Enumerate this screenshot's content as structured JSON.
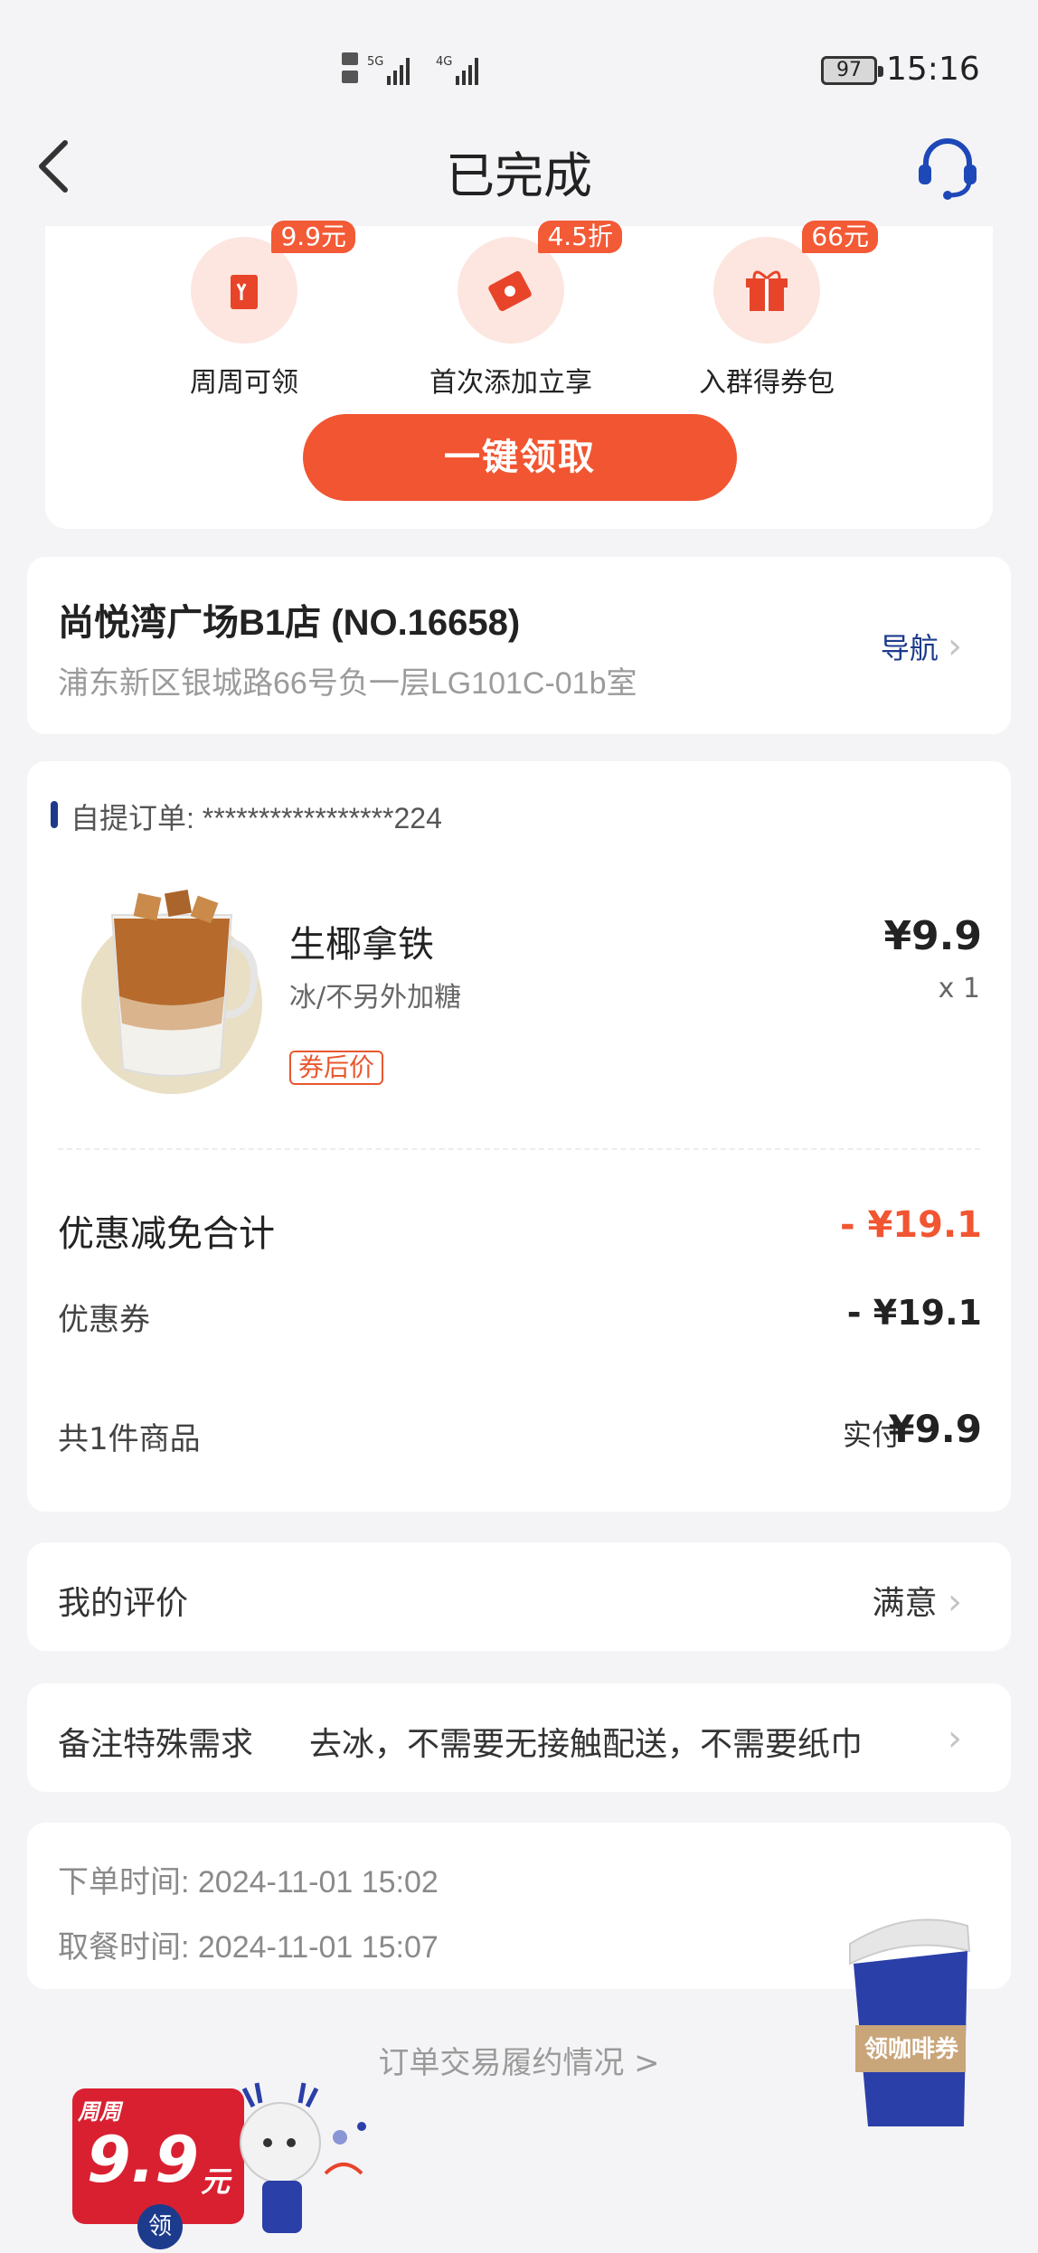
{
  "status_bar": {
    "time": "15:16",
    "battery": "97",
    "network_1": "5G",
    "network_2": "4G"
  },
  "header": {
    "title": "已完成"
  },
  "coupons": {
    "items": [
      {
        "label": "周周可领",
        "badge": "9.9元"
      },
      {
        "label": "首次添加立享",
        "badge": "4.5折"
      },
      {
        "label": "入群得券包",
        "badge": "66元"
      }
    ],
    "claim_button": "一键领取"
  },
  "store": {
    "name": "尚悦湾广场B1店 (NO.16658)",
    "address": "浦东新区银城路66号负一层LG101C-01b室",
    "nav_label": "导航"
  },
  "order": {
    "number_label": "自提订单: *****************224",
    "product": {
      "name": "生椰拿铁",
      "spec": "冰/不另外加糖",
      "tag": "券后价",
      "price": "¥9.9",
      "qty": "x 1"
    },
    "discount_total_label": "优惠减免合计",
    "discount_total_value": "- ¥19.1",
    "coupon_label": "优惠券",
    "coupon_value": "- ¥19.1",
    "items_count_label": "共1件商品",
    "paid_label": "实付",
    "paid_value": "¥9.9"
  },
  "rating": {
    "label": "我的评价",
    "value": "满意"
  },
  "remark": {
    "label": "备注特殊需求",
    "value": "去冰，不需要无接触配送，不需要纸巾"
  },
  "times": {
    "order_time": "下单时间:  2024-11-01 15:02",
    "pickup_time": "取餐时间:  2024-11-01 15:07"
  },
  "fulfil_link": "订单交易履约情况 >",
  "floating": {
    "coffee_label": "领咖啡券",
    "promo_top": "周周",
    "promo_amount": "9.9",
    "promo_unit": "元",
    "promo_claim": "领"
  },
  "colors": {
    "accent": "#f25531",
    "brand_blue": "#1d3b8c",
    "background": "#f4f4f6"
  }
}
